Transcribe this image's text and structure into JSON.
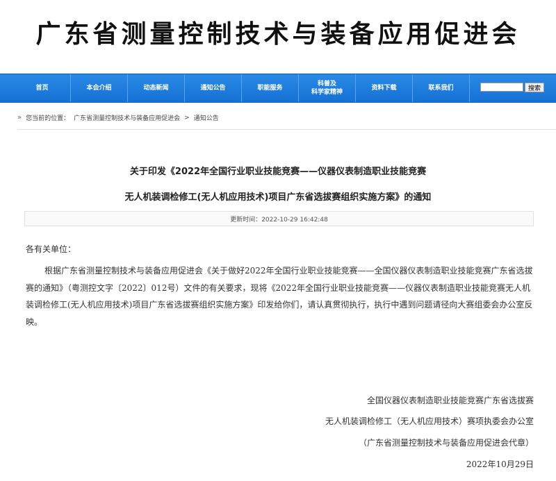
{
  "header": {
    "title": "广东省测量控制技术与装备应用促进会"
  },
  "nav": {
    "items": [
      "首页",
      "本会介绍",
      "动态新闻",
      "通知公告",
      "职能服务",
      "科普及",
      "资料下载",
      "联系我们"
    ],
    "item_science_line2": "科学家精神",
    "search_placeholder": "",
    "search_button": "搜索"
  },
  "breadcrumb": {
    "prefix": "您当前的位置：",
    "org": "广东省测量控制技术与装备应用促进会",
    "separator": ">",
    "current": "通知公告"
  },
  "article": {
    "title_line1": "关于印发《2022年全国行业职业技能竞赛——仪器仪表制造职业技能竞赛",
    "title_line2": "无人机装调检修工(无人机应用技术)项目广东省选拔赛组织实施方案》的通知",
    "meta": "更新时间：2022-10-29 16:42:48",
    "salutation": "各有关单位：",
    "paragraph": "根据广东省测量控制技术与装备应用促进会《关于做好2022年全国行业职业技能竞赛——全国仪器仪表制造职业技能竞赛广东省选拔赛的通知》（粤测控文字〔2022〕012号）文件的有关要求，现将《2022年全国行业职业技能竞赛——仪器仪表制造职业技能竞赛无人机装调检修工(无人机应用技术)项目广东省选拔赛组织实施方案》印发给你们，请认真贯彻执行，执行中遇到问题请径向大赛组委会办公室反映。",
    "signature_line1": "全国仪器仪表制造职业技能竞赛广东省选拔赛",
    "signature_line2": "无人机装调检修工（无人机应用技术）赛项执委会办公室",
    "signature_line3": "（广东省测量控制技术与装备应用促进会代章）",
    "date": "2022年10月29日"
  },
  "colors": {
    "nav_bg": "#1a78dc",
    "nav_text": "#ffffff"
  }
}
